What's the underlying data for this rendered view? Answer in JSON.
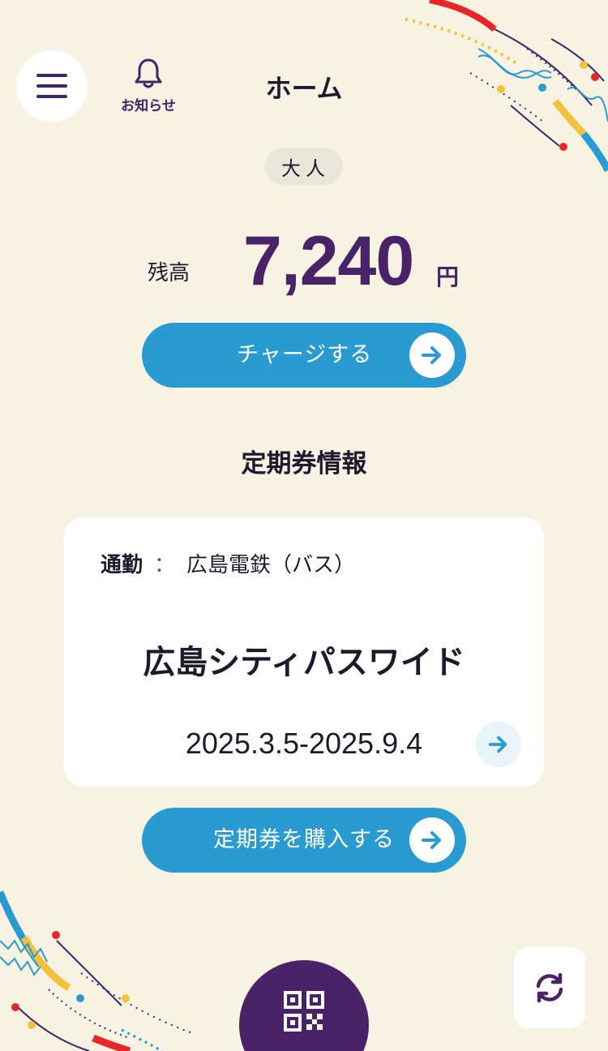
{
  "header": {
    "title": "ホーム",
    "menu_icon": "hamburger-menu-icon",
    "notice": {
      "label": "お知らせ",
      "icon": "bell-icon"
    }
  },
  "balance": {
    "fare_type": "大人",
    "label": "残高",
    "amount": "7,240",
    "unit": "円"
  },
  "charge_button": {
    "label": "チャージする",
    "icon": "arrow-right-icon"
  },
  "commuter_pass": {
    "section_title": "定期券情報",
    "type": "通勤",
    "separator": "：",
    "operator": "広島電鉄（バス）",
    "name": "広島シティパスワイド",
    "period": "2025.3.5-2025.9.4",
    "detail_icon": "arrow-right-icon"
  },
  "purchase_button": {
    "label": "定期券を購入する",
    "icon": "arrow-right-icon"
  },
  "bottom": {
    "qr_icon": "qr-code-icon",
    "refresh_icon": "refresh-icon"
  },
  "colors": {
    "background": "#F6F3E3",
    "primary_purple": "#4A2268",
    "accent_blue": "#2A9BD0",
    "deco_red": "#E8262A",
    "deco_yellow": "#F2C23C",
    "deco_blue": "#2A9BD0"
  }
}
